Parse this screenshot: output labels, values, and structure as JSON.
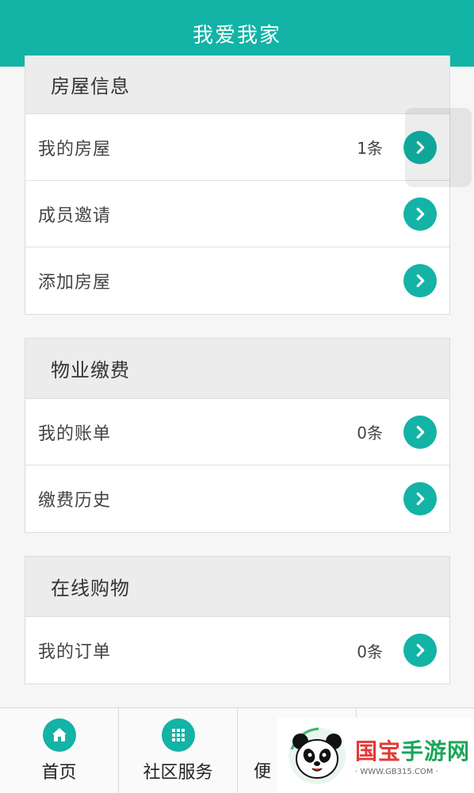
{
  "header": {
    "title": "我爱我家"
  },
  "sections": [
    {
      "title": "房屋信息",
      "rows": [
        {
          "label": "我的房屋",
          "count": "1条"
        },
        {
          "label": "成员邀请",
          "count": ""
        },
        {
          "label": "添加房屋",
          "count": ""
        }
      ]
    },
    {
      "title": "物业缴费",
      "rows": [
        {
          "label": "我的账单",
          "count": "0条"
        },
        {
          "label": "缴费历史",
          "count": ""
        }
      ]
    },
    {
      "title": "在线购物",
      "rows": [
        {
          "label": "我的订单",
          "count": "0条"
        }
      ]
    }
  ],
  "tabbar": {
    "tabs": [
      {
        "label": "首页",
        "icon": "home-icon"
      },
      {
        "label": "社区服务",
        "icon": "grid-icon"
      },
      {
        "label": "便",
        "icon": ""
      }
    ]
  },
  "watermark": {
    "brand_a": "国宝",
    "brand_b": "手游网",
    "url": "· WWW.GB315.COM ·"
  },
  "colors": {
    "accent": "#13b3a6",
    "background": "#f6f6f6"
  }
}
